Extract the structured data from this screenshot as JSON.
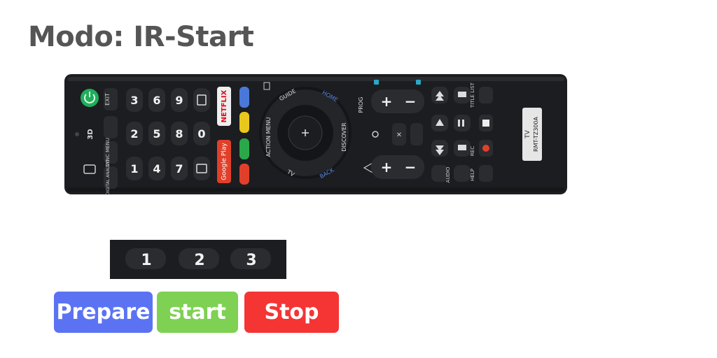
{
  "header": {
    "title": "Modo: IR-Start"
  },
  "remote": {
    "labels": {
      "exit": "EXIT",
      "sync_menu": "SYNC MENU",
      "digital_analog": "DIGITAL ANALOG",
      "netflix": "NETFLIX",
      "google_play": "Google Play",
      "guide": "GUIDE",
      "home": "HOME",
      "action_menu": "ACTION MENU",
      "discover": "DISCOVER",
      "tv_nav": "TV",
      "back": "BACK",
      "prog": "PROG",
      "title_list": "TITLE LIST",
      "rec": "REC",
      "audio": "AUDIO",
      "help": "HELP",
      "tv_badge": "TV",
      "model": "RMT-TZ300A"
    },
    "digits": [
      "1",
      "2",
      "3",
      "4",
      "5",
      "6",
      "7",
      "8",
      "9",
      "0"
    ],
    "colors": {
      "blue": "#4a78d8",
      "yellow": "#e8c81c",
      "green": "#2aa84a",
      "red": "#e0402a",
      "power": "#1fae5a",
      "netflix": "#e50914",
      "google_play": "#e0402a",
      "body": "#1c1d20"
    }
  },
  "crop": {
    "digits": [
      "1",
      "2",
      "3"
    ]
  },
  "actions": {
    "prepare_label": "Prepare",
    "start_label": "start",
    "stop_label": "Stop",
    "colors": {
      "prepare": "#5b73f3",
      "start": "#7ed153",
      "stop": "#f53434"
    }
  }
}
